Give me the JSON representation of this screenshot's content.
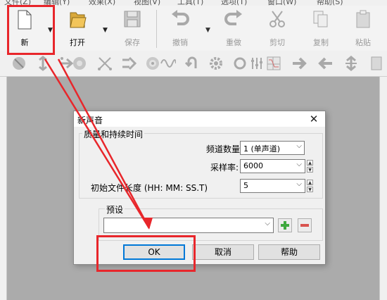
{
  "menubar": {
    "items": [
      "文件(Z)",
      "编辑(Y)",
      "效果(X)",
      "视图(V)",
      "工具(T)",
      "选项(T)",
      "窗口(W)",
      "帮助(S)"
    ]
  },
  "toolbar": {
    "new_label": "新",
    "open_label": "打开",
    "save_label": "保存",
    "undo_label": "撤销",
    "redo_label": "重做",
    "cut_label": "剪切",
    "copy_label": "复制",
    "paste_label": "粘贴"
  },
  "dialog": {
    "title": "新声音",
    "close_glyph": "✕",
    "group_title": "质量和持续时间",
    "channels": {
      "label": "频道数量:",
      "value": "1 (单声道)"
    },
    "sample_rate": {
      "label": "采样率:",
      "value": "6000"
    },
    "length": {
      "label": "初始文件长度 (HH: MM: SS.T)",
      "value": "5"
    },
    "preset": {
      "label": "预设",
      "value": ""
    },
    "ok_label": "OK",
    "cancel_label": "取消",
    "help_label": "帮助"
  },
  "colors": {
    "highlight": "#e8262b",
    "add_green": "#3fa93f",
    "remove_red": "#d9534f"
  }
}
